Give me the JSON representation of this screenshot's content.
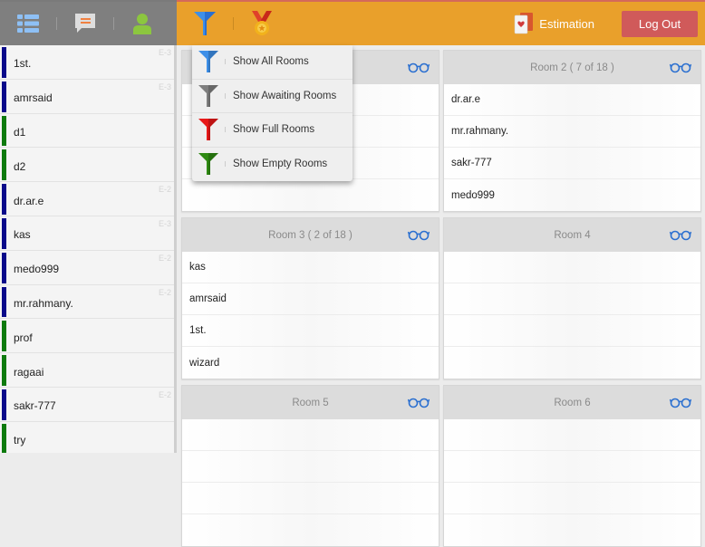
{
  "topbar": {
    "icons": [
      "list-icon",
      "chat-icon",
      "user-icon",
      "filter-icon",
      "medal-icon"
    ],
    "estimation_label": "Estimation",
    "logout_label": "Log Out",
    "colors": {
      "left_bg": "#7f7f7f",
      "right_bg": "#e9a02b",
      "logout_bg": "#d05a5a"
    }
  },
  "filter_menu": {
    "items": [
      {
        "label": "Show All Rooms",
        "icon": "filter-blue-icon",
        "color": "#3d8fe8"
      },
      {
        "label": "Show Awaiting Rooms",
        "icon": "filter-gray-icon",
        "color": "#7e7e7e"
      },
      {
        "label": "Show Full Rooms",
        "icon": "filter-red-icon",
        "color": "#e81818"
      },
      {
        "label": "Show Empty Rooms",
        "icon": "filter-green-icon",
        "color": "#2e8a12"
      }
    ]
  },
  "players": [
    {
      "name": "1st.",
      "level": "E-3",
      "status_color": "#0a0a8a"
    },
    {
      "name": "amrsaid",
      "level": "E-3",
      "status_color": "#0a0a8a"
    },
    {
      "name": "d1",
      "level": "",
      "status_color": "#0d7a0d"
    },
    {
      "name": "d2",
      "level": "",
      "status_color": "#0d7a0d"
    },
    {
      "name": "dr.ar.e",
      "level": "E-2",
      "status_color": "#0a0a8a"
    },
    {
      "name": "kas",
      "level": "E-3",
      "status_color": "#0a0a8a"
    },
    {
      "name": "medo999",
      "level": "E-2",
      "status_color": "#0a0a8a"
    },
    {
      "name": "mr.rahmany.",
      "level": "E-2",
      "status_color": "#0a0a8a"
    },
    {
      "name": "prof",
      "level": "",
      "status_color": "#0d7a0d"
    },
    {
      "name": "ragaai",
      "level": "",
      "status_color": "#0d7a0d"
    },
    {
      "name": "sakr-777",
      "level": "E-2",
      "status_color": "#0a0a8a"
    },
    {
      "name": "try",
      "level": "",
      "status_color": "#0d7a0d"
    }
  ],
  "rooms": [
    {
      "title": "",
      "players": [
        "",
        "",
        "",
        ""
      ]
    },
    {
      "title": "Room 2 ( 7 of 18 )",
      "players": [
        "dr.ar.e",
        "mr.rahmany.",
        "sakr-777",
        "medo999"
      ]
    },
    {
      "title": "Room 3 ( 2 of 18 )",
      "players": [
        "kas",
        "amrsaid",
        "1st.",
        "wizard"
      ]
    },
    {
      "title": "Room 4",
      "players": [
        "",
        "",
        "",
        ""
      ]
    },
    {
      "title": "Room 5",
      "players": [
        "",
        "",
        "",
        ""
      ]
    },
    {
      "title": "Room 6",
      "players": [
        "",
        "",
        "",
        ""
      ]
    }
  ]
}
